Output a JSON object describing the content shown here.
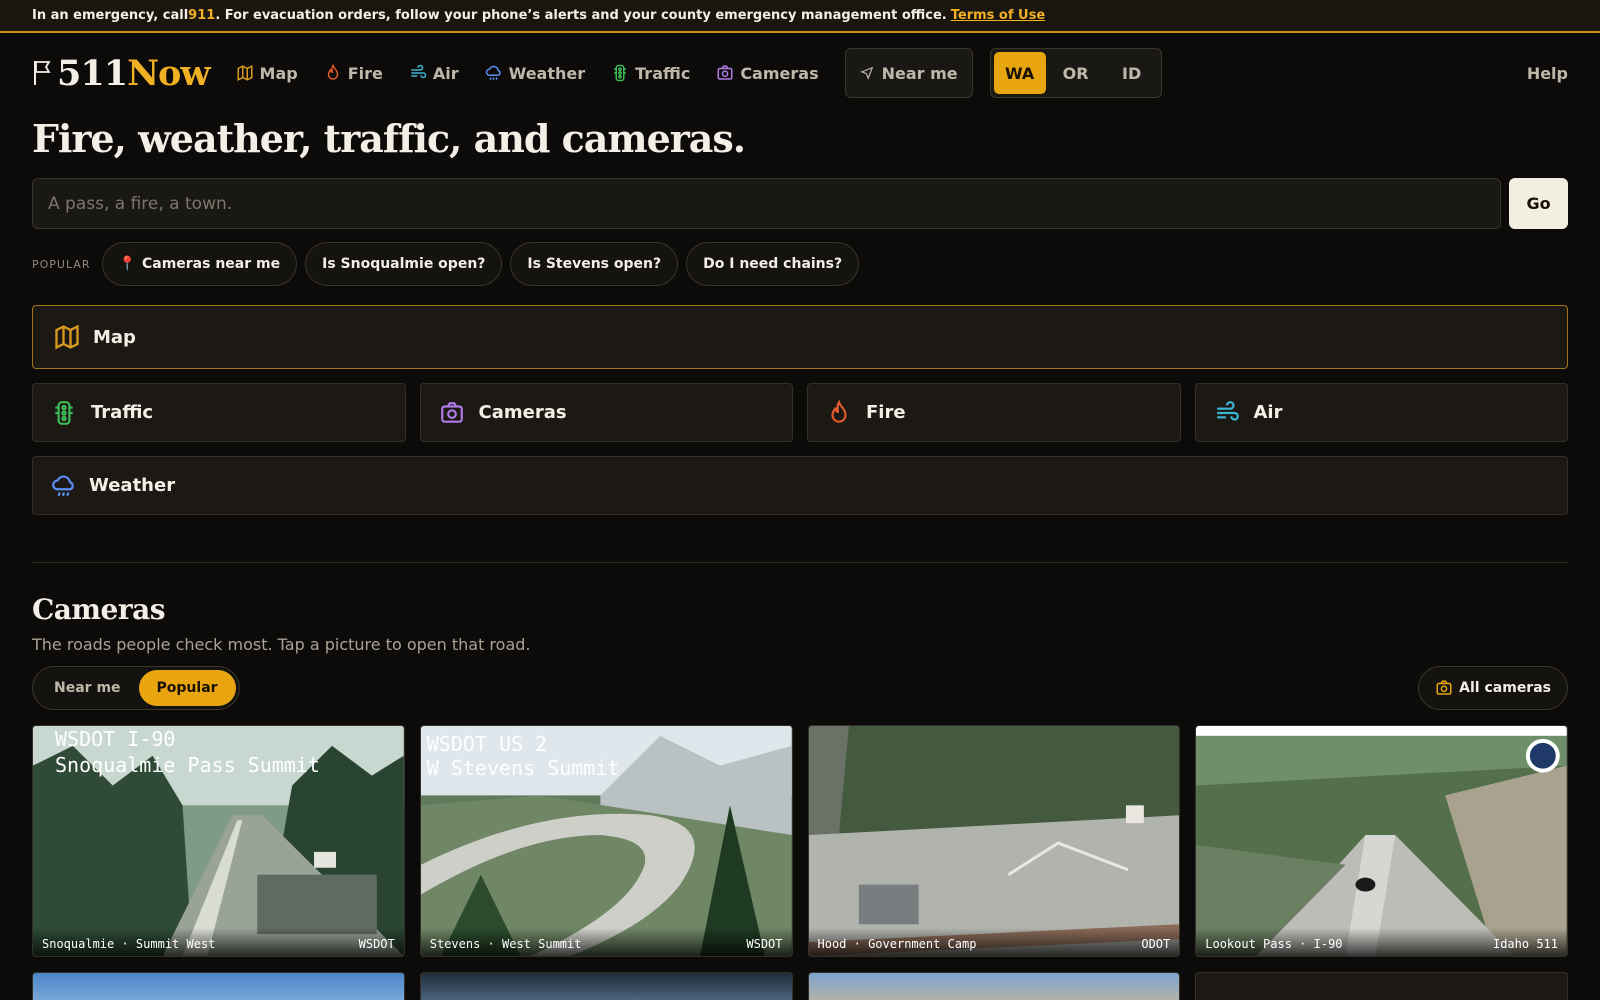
{
  "banner": {
    "pre": "In an emergency, call ",
    "number": "911",
    "post": ". For evacuation orders, follow your phone’s alerts and your county emergency management office.",
    "terms_link": "Terms of Use"
  },
  "logo": {
    "part1": "511",
    "part2": "Now"
  },
  "nav": {
    "links": [
      {
        "label": "Map",
        "icon": "map-icon",
        "color": "#d99a1e"
      },
      {
        "label": "Fire",
        "icon": "fire-icon",
        "color": "#e05a2b"
      },
      {
        "label": "Air",
        "icon": "wind-icon",
        "color": "#3bb6d6"
      },
      {
        "label": "Weather",
        "icon": "cloud-rain-icon",
        "color": "#5b8ef0"
      },
      {
        "label": "Traffic",
        "icon": "traffic-light-icon",
        "color": "#3cba54"
      },
      {
        "label": "Cameras",
        "icon": "camera-icon",
        "color": "#b07ae8"
      }
    ],
    "near_me": "Near me",
    "states": [
      "WA",
      "OR",
      "ID"
    ],
    "active_state": "WA",
    "help": "Help"
  },
  "hero": {
    "title": "Fire, weather, traffic, and cameras.",
    "search_placeholder": "A pass, a fire, a town.",
    "go": "Go",
    "popular_label": "POPULAR",
    "popular": [
      "Cameras near me",
      "Is Snoqualmie open?",
      "Is Stevens open?",
      "Do I need chains?"
    ]
  },
  "tiles": {
    "map": "Map",
    "row": [
      {
        "label": "Traffic",
        "icon": "traffic-light-icon"
      },
      {
        "label": "Cameras",
        "icon": "camera-icon"
      },
      {
        "label": "Fire",
        "icon": "fire-icon"
      },
      {
        "label": "Air",
        "icon": "wind-icon"
      }
    ],
    "weather": "Weather"
  },
  "cameras": {
    "title": "Cameras",
    "subtitle": "The roads people check most. Tap a picture to open that road.",
    "tabs": [
      "Near me",
      "Popular"
    ],
    "active_tab": "Popular",
    "all": "All cameras",
    "items": [
      {
        "caption": "Snoqualmie · Summit West",
        "source": "WSDOT",
        "overlay1": "WSDOT I-90",
        "overlay2": "Snoqualmie Pass Summit"
      },
      {
        "caption": "Stevens · West Summit",
        "source": "WSDOT",
        "overlay1": "WSDOT US 2",
        "overlay2": "W Stevens Summit"
      },
      {
        "caption": "Hood · Government Camp",
        "source": "ODOT",
        "overlay1": "",
        "overlay2": ""
      },
      {
        "caption": "Lookout Pass · I-90",
        "source": "Idaho 511",
        "overlay1": "",
        "overlay2": ""
      }
    ]
  }
}
